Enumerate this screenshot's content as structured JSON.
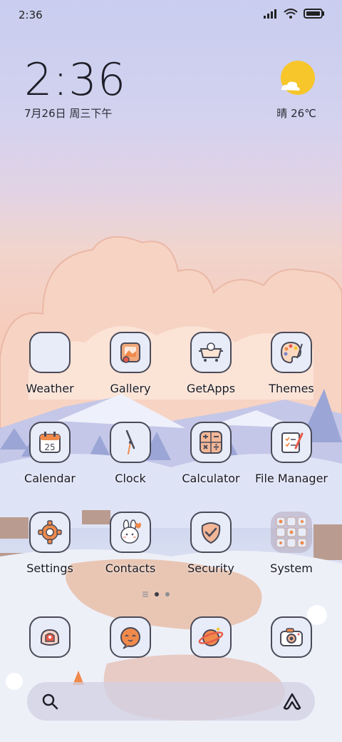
{
  "status_bar": {
    "time": "2:36",
    "signal_icon": "signal-bars-icon",
    "wifi_icon": "wifi-icon",
    "battery_icon": "battery-full-icon"
  },
  "clock_widget": {
    "time": "2:36",
    "date": "7月26日 周三下午"
  },
  "weather_widget": {
    "condition_icon": "sun-with-cloud-icon",
    "text": "晴 26℃"
  },
  "apps": [
    {
      "label": "Weather",
      "icon": "weather-icon"
    },
    {
      "label": "Gallery",
      "icon": "gallery-icon"
    },
    {
      "label": "GetApps",
      "icon": "getapps-icon"
    },
    {
      "label": "Themes",
      "icon": "themes-palette-icon"
    },
    {
      "label": "Calendar",
      "icon": "calendar-icon",
      "day": "25"
    },
    {
      "label": "Clock",
      "icon": "clock-icon"
    },
    {
      "label": "Calculator",
      "icon": "calculator-icon"
    },
    {
      "label": "File Manager",
      "icon": "file-manager-icon"
    },
    {
      "label": "Settings",
      "icon": "settings-gear-icon"
    },
    {
      "label": "Contacts",
      "icon": "contacts-bunny-icon"
    },
    {
      "label": "Security",
      "icon": "security-shield-icon"
    },
    {
      "label": "System",
      "icon": "system-folder-icon"
    }
  ],
  "page_indicator": {
    "pages": 2,
    "current": 1
  },
  "dock": [
    {
      "icon": "phone-icon"
    },
    {
      "icon": "messages-icon"
    },
    {
      "icon": "browser-planet-icon"
    },
    {
      "icon": "camera-icon"
    }
  ],
  "search_bar": {
    "search_icon": "search-icon",
    "assistant_icon": "assistant-icon"
  },
  "colors": {
    "accent_orange": "#f08a4b",
    "icon_bg": "#e7ecf8",
    "icon_border": "#4a4a58",
    "sun": "#f6c62a"
  }
}
